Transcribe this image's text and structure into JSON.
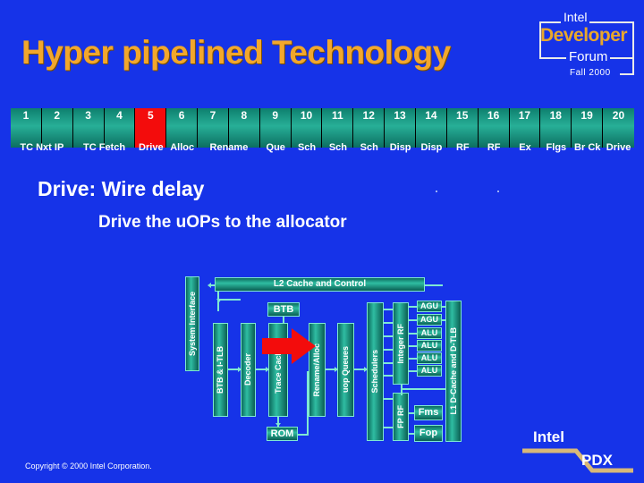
{
  "slide": {
    "background_color": "#1633E8",
    "title": "Hyper pipelined Technology",
    "title_color": "#F2A72C",
    "heading": "Drive: Wire delay",
    "subheading": "Drive the uOPs to the allocator",
    "copyright": "Copyright © 2000 Intel Corporation."
  },
  "logo": {
    "intel": "Intel",
    "developer": "Developer",
    "forum": "Forum",
    "edition": "Fall 2000",
    "developer_color": "#E9A72B"
  },
  "footer_logo": {
    "intel": "Intel",
    "pdx": "PDX",
    "line_color": "#D8B878"
  },
  "pipeline": {
    "highlight_color": "#F30C0C",
    "cell_color": "#27AF97",
    "stages": [
      {
        "num": "1"
      },
      {
        "num": "2"
      },
      {
        "num": "3"
      },
      {
        "num": "4"
      },
      {
        "num": "5",
        "highlight": true
      },
      {
        "num": "6"
      },
      {
        "num": "7"
      },
      {
        "num": "8"
      },
      {
        "num": "9"
      },
      {
        "num": "10"
      },
      {
        "num": "11"
      },
      {
        "num": "12"
      },
      {
        "num": "13"
      },
      {
        "num": "14"
      },
      {
        "num": "15"
      },
      {
        "num": "16"
      },
      {
        "num": "17"
      },
      {
        "num": "18"
      },
      {
        "num": "19"
      },
      {
        "num": "20"
      }
    ],
    "labels": [
      {
        "text": "TC Nxt IP",
        "start": 1,
        "span": 2,
        "highlight": false
      },
      {
        "text": "TC Fetch",
        "start": 3,
        "span": 2,
        "highlight": false
      },
      {
        "text": "Drive",
        "start": 5,
        "span": 1,
        "highlight": true
      },
      {
        "text": "Alloc",
        "start": 6,
        "span": 1,
        "highlight": false
      },
      {
        "text": "Rename",
        "start": 7,
        "span": 2,
        "highlight": false
      },
      {
        "text": "Que",
        "start": 9,
        "span": 1,
        "highlight": false
      },
      {
        "text": "Sch",
        "start": 10,
        "span": 1,
        "highlight": false
      },
      {
        "text": "Sch",
        "start": 11,
        "span": 1,
        "highlight": false
      },
      {
        "text": "Sch",
        "start": 12,
        "span": 1,
        "highlight": false
      },
      {
        "text": "Disp",
        "start": 13,
        "span": 1,
        "highlight": false
      },
      {
        "text": "Disp",
        "start": 14,
        "span": 1,
        "highlight": false
      },
      {
        "text": "RF",
        "start": 15,
        "span": 1,
        "highlight": false
      },
      {
        "text": "RF",
        "start": 16,
        "span": 1,
        "highlight": false
      },
      {
        "text": "Ex",
        "start": 17,
        "span": 1,
        "highlight": false
      },
      {
        "text": "Flgs",
        "start": 18,
        "span": 1,
        "highlight": false
      },
      {
        "text": "Br Ck",
        "start": 19,
        "span": 1,
        "highlight": false
      },
      {
        "text": "Drive",
        "start": 20,
        "span": 1,
        "highlight": false
      }
    ]
  },
  "diagram": {
    "accent_color": "#2FBDA2",
    "arrow_color": "#F30C0C",
    "blocks": {
      "system_interface": "System Interface",
      "l2_cache": "L2 Cache and Control",
      "btb_top": "BTB",
      "btb_itlb": "BTB & I-TLB",
      "decoder": "Decoder",
      "trace_cache": "Trace Cache",
      "rom": "ROM",
      "rename_alloc": "Rename/Alloc",
      "uop_queues": "uop Queues",
      "schedulers": "Schedulers",
      "integer_rf": "Integer RF",
      "fp_rf": "FP RF",
      "agu1": "AGU",
      "agu2": "AGU",
      "alu1": "ALU",
      "alu2": "ALU",
      "alu3": "ALU",
      "alu4": "ALU",
      "fms": "Fms",
      "fop": "Fop",
      "l1_dcache": "L1 D-Cache and D-TLB"
    }
  }
}
